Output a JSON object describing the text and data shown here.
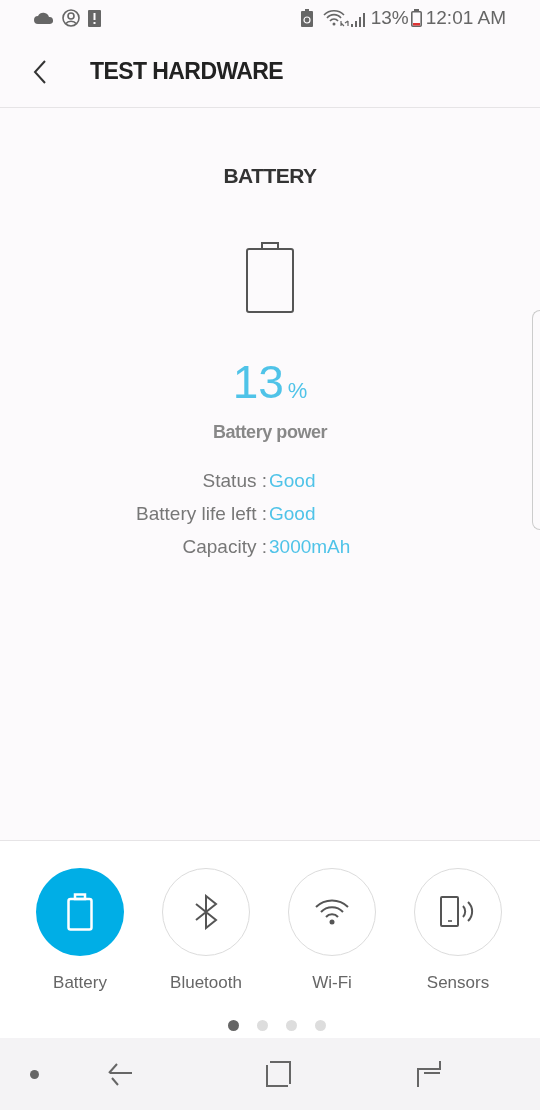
{
  "status_bar": {
    "battery_percent": "13%",
    "time": "12:01 AM"
  },
  "header": {
    "title": "TEST HARDWARE"
  },
  "section_title": "BATTERY",
  "battery": {
    "percent": "13",
    "unit": "%",
    "caption": "Battery power",
    "details": [
      {
        "label": "Status :",
        "value": "Good"
      },
      {
        "label": "Battery life left :",
        "value": "Good"
      },
      {
        "label": "Capacity :",
        "value": "3000mAh"
      }
    ]
  },
  "tabs": [
    {
      "label": "Battery",
      "kind": "battery",
      "selected": true
    },
    {
      "label": "Bluetooth",
      "kind": "bluetooth",
      "selected": false
    },
    {
      "label": "Wi-Fi",
      "kind": "wifi",
      "selected": false
    },
    {
      "label": "Sensors",
      "kind": "sensors",
      "selected": false
    }
  ],
  "pages": [
    {
      "selected": true
    },
    {
      "selected": false
    },
    {
      "selected": false
    },
    {
      "selected": false
    }
  ]
}
